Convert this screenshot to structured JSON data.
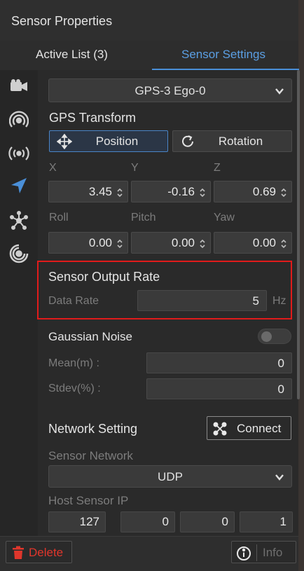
{
  "window": {
    "title": "Sensor Properties"
  },
  "tabs": [
    {
      "label": "Active List  (3)",
      "active": false
    },
    {
      "label": "Sensor Settings",
      "active": true
    }
  ],
  "sidebar": {
    "icons": [
      "camera-icon",
      "radar-icon",
      "broadcast-icon",
      "gps-navigation-icon",
      "lidar-icon",
      "ultrasonic-icon"
    ],
    "active_icon": "gps-navigation-icon"
  },
  "sensor_select": {
    "value": "GPS-3   Ego-0"
  },
  "gps_transform": {
    "heading": "GPS Transform",
    "position_label": "Position",
    "rotation_label": "Rotation",
    "position_axes": [
      "X",
      "Y",
      "Z"
    ],
    "position_values": [
      "3.45",
      "-0.16",
      "0.69"
    ],
    "rotation_axes": [
      "Roll",
      "Pitch",
      "Yaw"
    ],
    "rotation_values": [
      "0.00",
      "0.00",
      "0.00"
    ]
  },
  "output_rate": {
    "heading": "Sensor Output Rate",
    "label": "Data Rate",
    "value": "5",
    "unit": "Hz"
  },
  "gaussian_noise": {
    "heading": "Gaussian Noise",
    "enabled": false,
    "mean_label": "Mean(m) :",
    "mean_value": "0",
    "stdev_label": "Stdev(%) :",
    "stdev_value": "0"
  },
  "network": {
    "heading": "Network Setting",
    "connect_label": "Connect",
    "sensor_network_label": "Sensor Network",
    "sensor_network_value": "UDP",
    "host_ip_label": "Host Sensor IP",
    "host_ip_octets": [
      "127",
      "0",
      "0",
      "1"
    ]
  },
  "footer": {
    "delete_label": "Delete",
    "info_label": "Info"
  },
  "colors": {
    "accent": "#5b9fe4",
    "danger": "#e0362c",
    "highlight": "#e01b1b",
    "panel": "#2b2b2b"
  }
}
